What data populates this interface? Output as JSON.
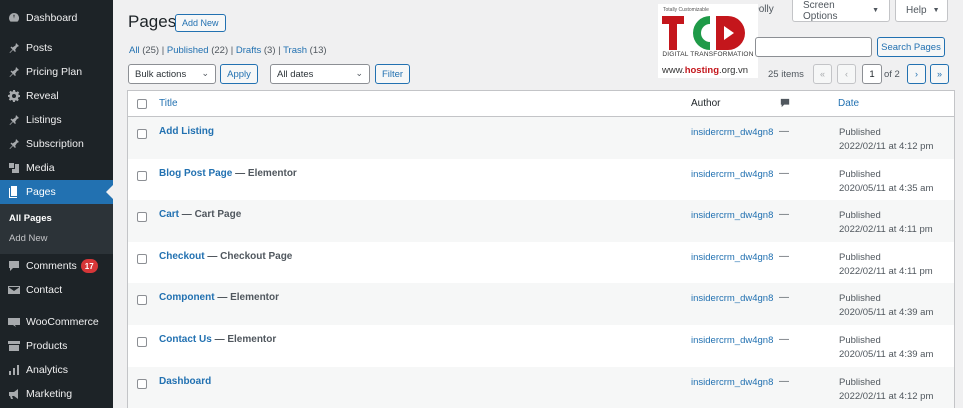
{
  "sidebar": {
    "items": [
      {
        "label": "Dashboard",
        "icon": "dashboard-icon"
      },
      {
        "label": "Posts",
        "icon": "pin-icon"
      },
      {
        "label": "Pricing Plan",
        "icon": "pin-icon"
      },
      {
        "label": "Reveal",
        "icon": "gear-icon"
      },
      {
        "label": "Listings",
        "icon": "pin-icon"
      },
      {
        "label": "Subscription",
        "icon": "pin-icon"
      },
      {
        "label": "Media",
        "icon": "media-icon"
      },
      {
        "label": "Pages",
        "icon": "pages-icon"
      },
      {
        "label": "Comments",
        "icon": "comment-icon",
        "badge": "17"
      },
      {
        "label": "Contact",
        "icon": "mail-icon"
      },
      {
        "label": "WooCommerce",
        "icon": "woo-icon"
      },
      {
        "label": "Products",
        "icon": "products-icon"
      },
      {
        "label": "Analytics",
        "icon": "analytics-icon"
      },
      {
        "label": "Marketing",
        "icon": "megaphone-icon"
      }
    ],
    "submenu": [
      "All Pages",
      "Add New"
    ]
  },
  "topbar": {
    "howdy": "Well, hello, Dolly",
    "screen_options": "Screen Options",
    "help": "Help"
  },
  "logo": {
    "tagline": "Totally Customizable",
    "subtitle": "DIGITAL TRANSFORMATION",
    "url_prefix": "www.",
    "url_brand": "hosting",
    "url_suffix": ".org.vn"
  },
  "header": {
    "title": "Pages",
    "add_new": "Add New"
  },
  "filters": {
    "all": "All",
    "all_count": "(25)",
    "published": "Published",
    "published_count": "(22)",
    "drafts": "Drafts",
    "drafts_count": "(3)",
    "trash": "Trash",
    "trash_count": "(13)"
  },
  "search": {
    "button": "Search Pages",
    "value": ""
  },
  "tablenav": {
    "bulk_actions": "Bulk actions",
    "apply": "Apply",
    "all_dates": "All dates",
    "filter": "Filter",
    "items_count": "25 items",
    "first": "«",
    "prev": "‹",
    "current_page": "1",
    "of_pages": "of 2",
    "next": "›",
    "last": "»"
  },
  "table": {
    "columns": {
      "title": "Title",
      "author": "Author",
      "date": "Date"
    },
    "rows": [
      {
        "title": "Add Listing",
        "state": "",
        "author": "insidercrm_dw4gn8",
        "comments": "—",
        "status": "Published",
        "date": "2022/02/11 at 4:12 pm"
      },
      {
        "title": "Blog Post Page",
        "state": " — Elementor",
        "author": "insidercrm_dw4gn8",
        "comments": "—",
        "status": "Published",
        "date": "2020/05/11 at 4:35 am"
      },
      {
        "title": "Cart",
        "state": " — Cart Page",
        "author": "insidercrm_dw4gn8",
        "comments": "—",
        "status": "Published",
        "date": "2022/02/11 at 4:11 pm"
      },
      {
        "title": "Checkout",
        "state": " — Checkout Page",
        "author": "insidercrm_dw4gn8",
        "comments": "—",
        "status": "Published",
        "date": "2022/02/11 at 4:11 pm"
      },
      {
        "title": "Component",
        "state": " — Elementor",
        "author": "insidercrm_dw4gn8",
        "comments": "—",
        "status": "Published",
        "date": "2020/05/11 at 4:39 am"
      },
      {
        "title": "Contact Us",
        "state": " — Elementor",
        "author": "insidercrm_dw4gn8",
        "comments": "—",
        "status": "Published",
        "date": "2020/05/11 at 4:39 am"
      },
      {
        "title": "Dashboard",
        "state": "",
        "author": "insidercrm_dw4gn8",
        "comments": "—",
        "status": "Published",
        "date": "2022/02/11 at 4:12 pm"
      }
    ]
  },
  "colors": {
    "sidebar_bg": "#1d2327",
    "accent": "#2271b1",
    "badge": "#d63638",
    "logo_red": "#c4161c",
    "logo_green": "#1f9a48"
  }
}
